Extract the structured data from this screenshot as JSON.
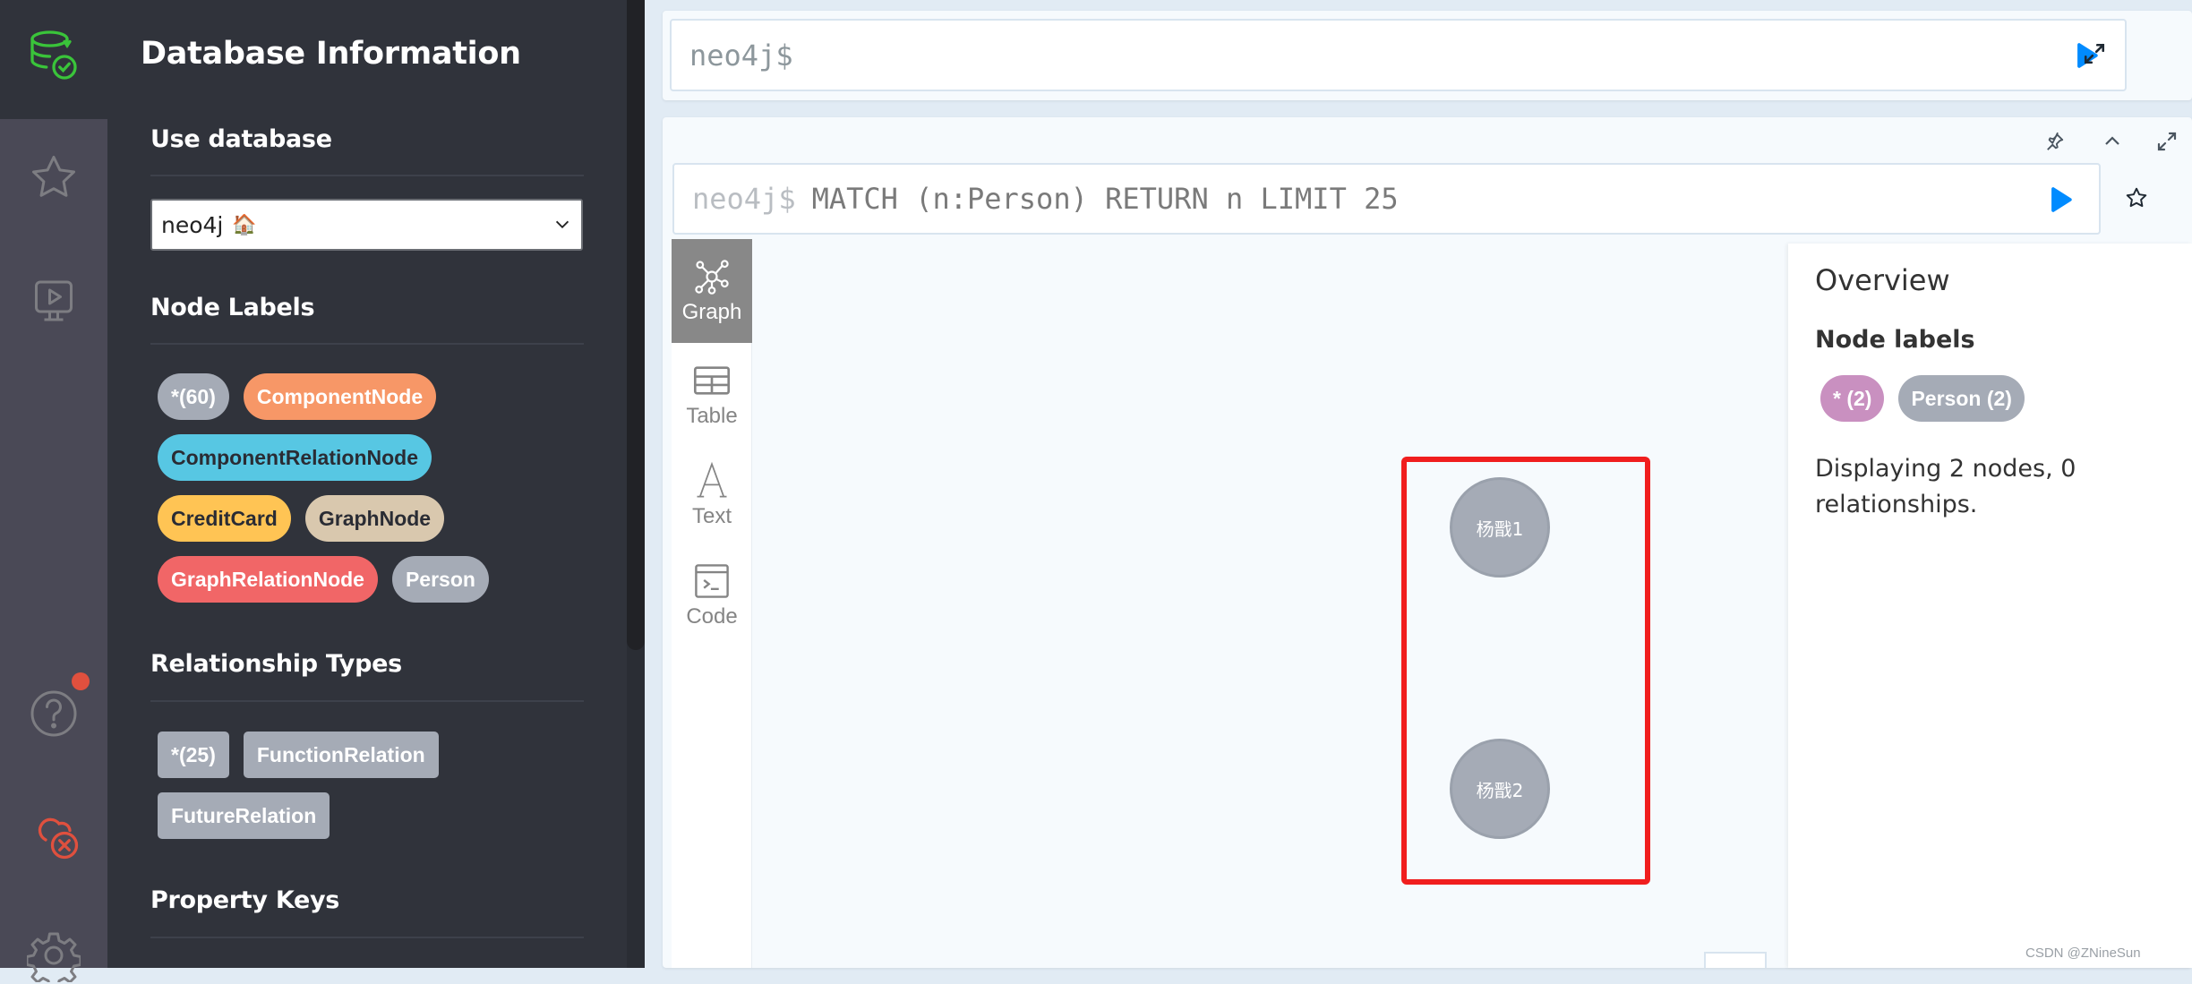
{
  "rail": {
    "items": [
      {
        "name": "database-icon",
        "color": "#3ac43a"
      },
      {
        "name": "star-icon",
        "color": "#7d7d82"
      },
      {
        "name": "monitor-play-icon",
        "color": "#7d7d82"
      },
      {
        "name": "help-icon",
        "color": "#7d7d82"
      },
      {
        "name": "cloud-disconnected-icon",
        "color": "#e0503e"
      },
      {
        "name": "gear-icon",
        "color": "#7d7d82"
      }
    ],
    "notification_color": "#e0503e"
  },
  "drawer": {
    "title": "Database Information",
    "use_database_heading": "Use database",
    "database_select": {
      "value": "neo4j",
      "home_emoji": "🏠"
    },
    "node_labels_heading": "Node Labels",
    "node_labels": [
      {
        "label": "*(60)",
        "bg": "#a5abb6",
        "fg": "#ffffff"
      },
      {
        "label": "ComponentNode",
        "bg": "#f79767",
        "fg": "#ffffff"
      },
      {
        "label": "ComponentRelationNode",
        "bg": "#57c7e3",
        "fg": "#2a2c34"
      },
      {
        "label": "CreditCard",
        "bg": "#ffc454",
        "fg": "#2a2c34"
      },
      {
        "label": "GraphNode",
        "bg": "#d9c8ae",
        "fg": "#2a2c34"
      },
      {
        "label": "GraphRelationNode",
        "bg": "#f16667",
        "fg": "#ffffff"
      },
      {
        "label": "Person",
        "bg": "#a5abb6",
        "fg": "#ffffff"
      }
    ],
    "relationship_types_heading": "Relationship Types",
    "relationship_types": [
      {
        "label": "*(25)",
        "bg": "#a5abb6",
        "fg": "#ffffff"
      },
      {
        "label": "FunctionRelation",
        "bg": "#a5abb6",
        "fg": "#ffffff"
      },
      {
        "label": "FutureRelation",
        "bg": "#a5abb6",
        "fg": "#ffffff"
      }
    ],
    "property_keys_heading": "Property Keys"
  },
  "main_editor": {
    "prompt": "neo4j$",
    "value": ""
  },
  "result_frame": {
    "prompt": "neo4j$",
    "query": "MATCH (n:Person) RETURN n LIMIT 25",
    "view_tabs": [
      {
        "label": "Graph",
        "icon": "graph-icon",
        "active": true
      },
      {
        "label": "Table",
        "icon": "table-icon",
        "active": false
      },
      {
        "label": "Text",
        "icon": "text-icon",
        "active": false
      },
      {
        "label": "Code",
        "icon": "code-icon",
        "active": false
      }
    ],
    "graph": {
      "nodes": [
        {
          "caption": "杨戬1",
          "label": "Person",
          "color": "#a5abb6"
        },
        {
          "caption": "杨戬2",
          "label": "Person",
          "color": "#a5abb6"
        }
      ],
      "relationships": [],
      "highlight_color": "#f01e1e"
    },
    "overview": {
      "title": "Overview",
      "node_labels_heading": "Node labels",
      "pills": [
        {
          "label": "* (2)",
          "bg": "#c990c0"
        },
        {
          "label": "Person (2)",
          "bg": "#a5abb6"
        }
      ],
      "summary": "Displaying 2 nodes, 0 relationships."
    }
  },
  "accent_color": "#018bff",
  "watermark": "CSDN @ZNineSun"
}
